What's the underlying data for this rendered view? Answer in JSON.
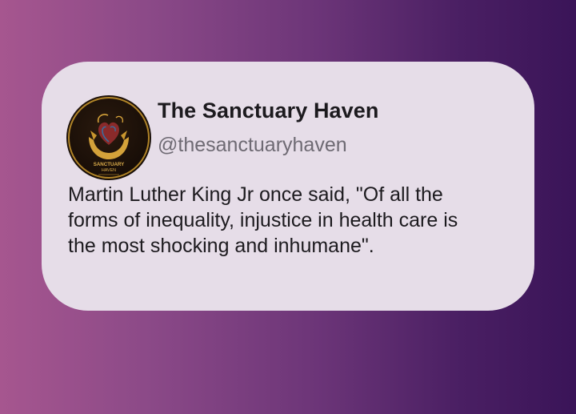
{
  "post": {
    "display_name": "The Sanctuary Haven",
    "handle": "@thesanctuaryhaven",
    "text_lines": [
      "Martin Luther King Jr once said, \"Of all the",
      "forms of inequality, injustice in health care is",
      "the most shocking and inhumane\"."
    ],
    "avatar_icon": "sanctuary-haven-logo",
    "avatar_text": [
      "SANCTUARY",
      "HAVEN"
    ]
  },
  "colors": {
    "background_start": "#a6568f",
    "background_end": "#3a1458",
    "card": "#e6dde8",
    "name_text": "#1c1a1e",
    "handle_text": "#6e6a73",
    "logo_gold": "#c8962e"
  }
}
